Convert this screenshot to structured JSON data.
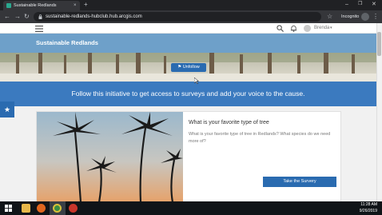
{
  "browser": {
    "tab_title": "Sustainable Redlands",
    "tab_close": "×",
    "new_tab": "+",
    "url": "sustainable-redlands-hubclub.hub.arcgis.com",
    "incognito_label": "Incognito",
    "window_controls": {
      "minimize": "–",
      "maximize": "❐",
      "close": "✕"
    },
    "nav": {
      "back": "←",
      "forward": "→",
      "reload": "↻",
      "star": "☆",
      "menu": "⋮"
    }
  },
  "site": {
    "title": "Sustainable Redlands",
    "user_name": "Brenda",
    "user_caret": "▾",
    "unfollow_label": "Unfollow",
    "cta_text": "Follow this initiative to get access to surveys and add your voice to the cause.",
    "side_star": "★"
  },
  "card": {
    "heading": "What is your favorite type of tree",
    "body": "What is your favorite type of tree in Redlands? What species do we need more of?",
    "button_label": "Take the Survery"
  },
  "taskbar": {
    "time": "11:28 AM",
    "date": "9/26/2019"
  },
  "colors": {
    "accent_blue": "#2a6bb0",
    "title_bar": "#6ea0c9",
    "cta_strip": "#3b7abf"
  },
  "icons": [
    "lock-icon",
    "search-icon",
    "bell-icon",
    "hamburger-icon",
    "windows-icon",
    "firefox-icon",
    "chrome-icon",
    "file-explorer-icon"
  ]
}
